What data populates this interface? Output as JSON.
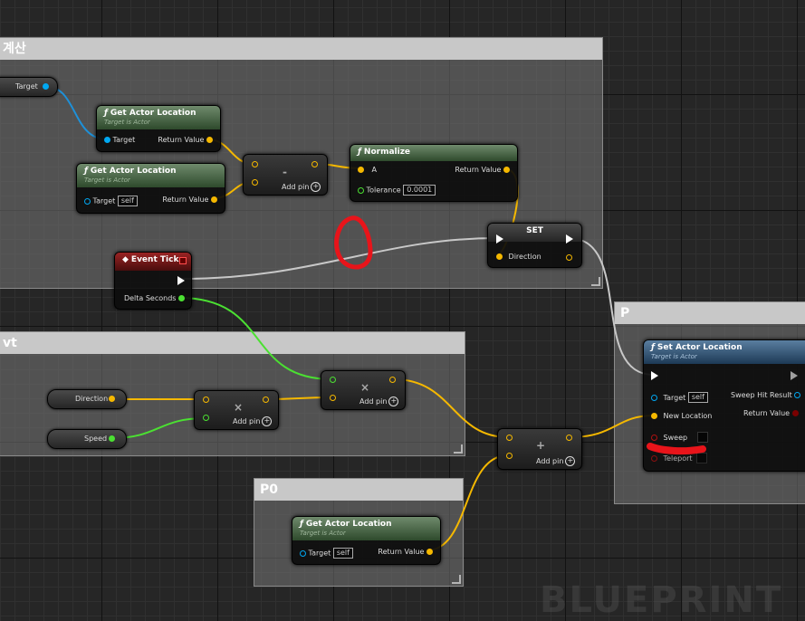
{
  "comments": {
    "top": "계산",
    "left": "vt",
    "right": "P",
    "bottom": "P0"
  },
  "nodes": {
    "target_var": "Target",
    "get_loc_1": {
      "title": "Get Actor Location",
      "sub": "Target is Actor",
      "in": "Target",
      "out": "Return Value"
    },
    "get_loc_2": {
      "title": "Get Actor Location",
      "sub": "Target is Actor",
      "in": "Target",
      "self": "self",
      "out": "Return Value"
    },
    "subtract": {
      "symbol": "-",
      "add_pin": "Add pin"
    },
    "normalize": {
      "title": "Normalize",
      "a": "A",
      "tolerance": "Tolerance",
      "tolerance_value": "0.0001",
      "out": "Return Value"
    },
    "set": {
      "title": "SET",
      "pin": "Direction"
    },
    "event_tick": {
      "title": "Event Tick",
      "out": "Delta Seconds"
    },
    "multiply_1": {
      "symbol": "×",
      "add_pin": "Add pin"
    },
    "multiply_2": {
      "symbol": "×",
      "add_pin": "Add pin"
    },
    "direction_var": "Direction",
    "speed_var": "Speed",
    "add": {
      "symbol": "+",
      "add_pin": "Add pin"
    },
    "get_loc_3": {
      "title": "Get Actor Location",
      "sub": "Target is Actor",
      "in": "Target",
      "self": "self",
      "out": "Return Value"
    },
    "set_loc": {
      "title": "Set Actor Location",
      "sub": "Target is Actor",
      "target": "Target",
      "self": "self",
      "new_location": "New Location",
      "sweep": "Sweep",
      "teleport": "Teleport",
      "sweep_hit": "Sweep Hit Result",
      "ret": "Return Value"
    }
  },
  "watermark": "BLUEPRINT",
  "colors": {
    "vector": "#f5b800",
    "float": "#4be032",
    "object": "#00a8f2",
    "exec": "#ffffff",
    "annotation": "#e8141a"
  }
}
